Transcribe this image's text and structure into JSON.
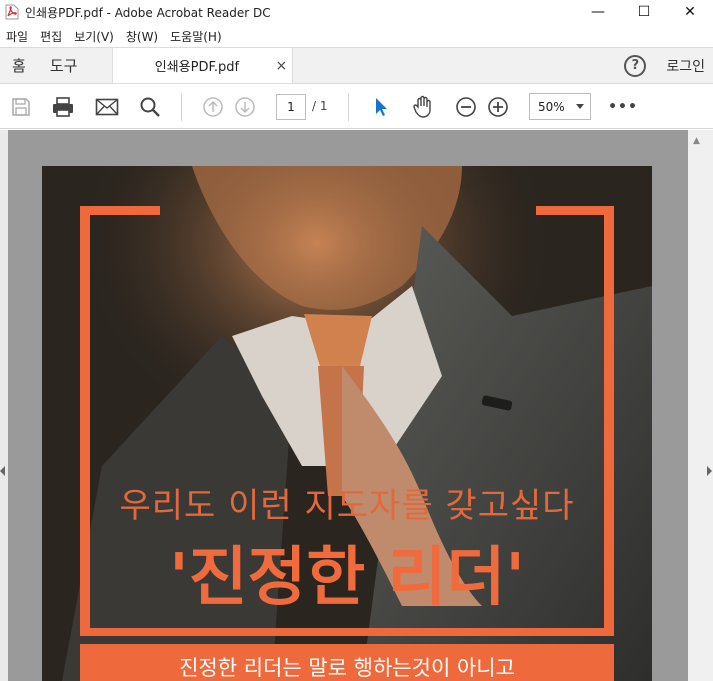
{
  "window": {
    "title": "인쇄용PDF.pdf - Adobe Acrobat Reader DC",
    "minimize": "—",
    "maximize": "☐",
    "close": "✕"
  },
  "menu": [
    {
      "label": "파일"
    },
    {
      "label": "편집"
    },
    {
      "label": "보기(V)"
    },
    {
      "label": "창(W)"
    },
    {
      "label": "도움말(H)"
    }
  ],
  "tabs": {
    "home": "홈",
    "tools": "도구",
    "document": "인쇄용PDF.pdf",
    "close": "×",
    "help": "?",
    "login": "로그인"
  },
  "toolbar": {
    "icons": [
      "save-icon",
      "print-icon",
      "email-icon",
      "search-icon",
      "page-up-icon",
      "page-down-icon",
      "select-cursor-icon",
      "hand-tool-icon",
      "zoom-out-icon",
      "zoom-in-icon",
      "more-icon"
    ],
    "page_current": "1",
    "page_total": "/ 1",
    "zoom": "50%",
    "more": "•••"
  },
  "document": {
    "headline_sub": "우리도 이런 지도자를 갖고싶다",
    "headline_main": "'진정한 리더'",
    "banner_text": "진정한 리더는 말로 행하는것이 아니고"
  },
  "colors": {
    "accent": "#ee6a3c",
    "cursor_blue": "#1a73c9"
  }
}
